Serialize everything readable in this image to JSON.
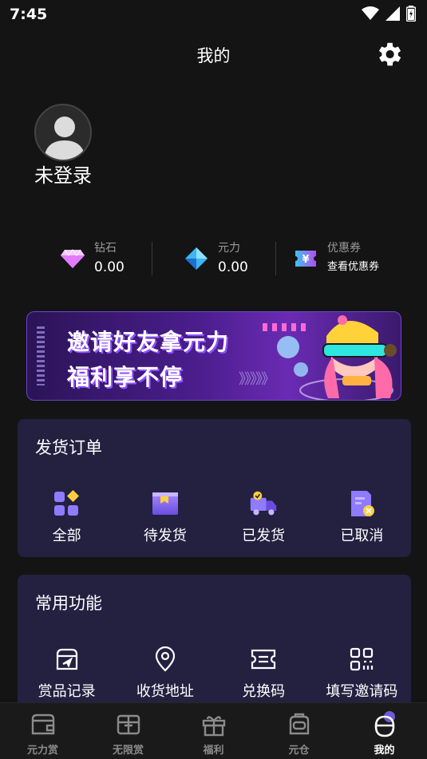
{
  "status_bar": {
    "time": "7:45"
  },
  "header": {
    "title": "我的"
  },
  "profile": {
    "login_status": "未登录"
  },
  "stats": [
    {
      "icon": "diamond-icon",
      "label": "钻石",
      "value": "0.00"
    },
    {
      "icon": "blue-crystal-icon",
      "label": "元力",
      "value": "0.00"
    },
    {
      "icon": "coupon-icon",
      "label": "优惠券",
      "value": "查看优惠券"
    }
  ],
  "banner": {
    "line1": "邀请好友拿元力",
    "line2": "福利享不停",
    "arrows": "》》》》》"
  },
  "orders": {
    "title": "发货订单",
    "items": [
      {
        "icon": "all-orders-icon",
        "label": "全部"
      },
      {
        "icon": "pending-shipment-icon",
        "label": "待发货"
      },
      {
        "icon": "shipped-truck-icon",
        "label": "已发货"
      },
      {
        "icon": "cancelled-order-icon",
        "label": "已取消"
      }
    ]
  },
  "functions": {
    "title": "常用功能",
    "items": [
      {
        "icon": "prize-record-icon",
        "label": "赏品记录"
      },
      {
        "icon": "location-pin-icon",
        "label": "收货地址"
      },
      {
        "icon": "redeem-ticket-icon",
        "label": "兑换码"
      },
      {
        "icon": "qr-code-icon",
        "label": "填写邀请码"
      }
    ]
  },
  "tabs": [
    {
      "icon": "wallet-icon",
      "label": "元力赏"
    },
    {
      "icon": "gift-box-icon",
      "label": "无限赏"
    },
    {
      "icon": "present-icon",
      "label": "福利"
    },
    {
      "icon": "warehouse-bag-icon",
      "label": "元仓"
    },
    {
      "icon": "profile-icon",
      "label": "我的",
      "active": true
    }
  ]
}
